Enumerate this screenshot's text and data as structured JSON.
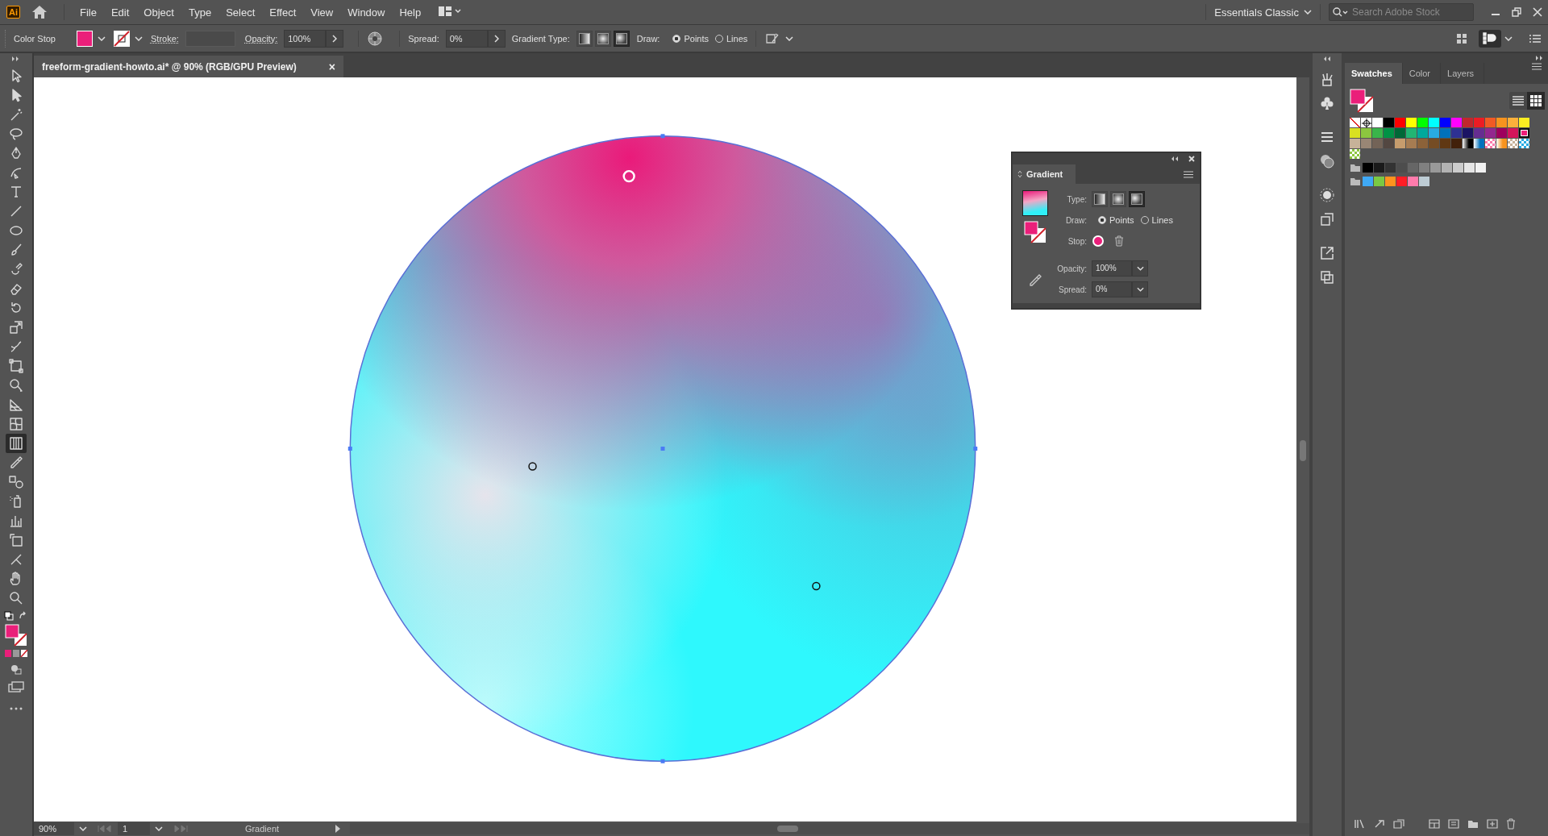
{
  "app_bar": {
    "logo": "Ai",
    "menu": [
      "File",
      "Edit",
      "Object",
      "Type",
      "Select",
      "Effect",
      "View",
      "Window",
      "Help"
    ],
    "workspace": "Essentials Classic",
    "search": {
      "placeholder": "Search Adobe Stock"
    }
  },
  "control_bar": {
    "label": "Color Stop",
    "stroke_label": "Stroke:",
    "opacity_label": "Opacity:",
    "opacity": "100%",
    "spread_label": "Spread:",
    "spread": "0%",
    "gradient_type_label": "Gradient Type:",
    "gradient_types": [
      {
        "kind": "linear",
        "selected": false
      },
      {
        "kind": "radial",
        "selected": false
      },
      {
        "kind": "freeform",
        "selected": true
      }
    ],
    "draw_label": "Draw:",
    "draw_options": [
      {
        "label": "Points",
        "selected": true
      },
      {
        "label": "Lines",
        "selected": false
      }
    ]
  },
  "document_tab": {
    "title": "freeform-gradient-howto.ai* @ 90% (RGB/GPU Preview)",
    "close": "×"
  },
  "tools": [
    {
      "kind": "selection",
      "selected": false
    },
    {
      "kind": "direct-selection",
      "selected": false
    },
    {
      "kind": "magic-wand",
      "selected": false
    },
    {
      "kind": "lasso",
      "selected": false
    },
    {
      "kind": "pen",
      "selected": false
    },
    {
      "kind": "curvature",
      "selected": false
    },
    {
      "kind": "type",
      "selected": false
    },
    {
      "kind": "line",
      "selected": false
    },
    {
      "kind": "ellipse",
      "selected": false
    },
    {
      "kind": "paintbrush",
      "selected": false
    },
    {
      "kind": "shaper",
      "selected": false
    },
    {
      "kind": "eraser",
      "selected": false
    },
    {
      "kind": "rotate",
      "selected": false
    },
    {
      "kind": "scale",
      "selected": false
    },
    {
      "kind": "warp",
      "selected": false
    },
    {
      "kind": "free-transform",
      "selected": false
    },
    {
      "kind": "shape-builder",
      "selected": false
    },
    {
      "kind": "perspective-grid",
      "selected": false
    },
    {
      "kind": "mesh",
      "selected": false
    },
    {
      "kind": "gradient",
      "selected": true
    },
    {
      "kind": "eyedropper",
      "selected": false
    },
    {
      "kind": "blend",
      "selected": false
    },
    {
      "kind": "symbol-sprayer",
      "selected": false
    },
    {
      "kind": "column-graph",
      "selected": false
    },
    {
      "kind": "artboard",
      "selected": false
    },
    {
      "kind": "slice",
      "selected": false
    },
    {
      "kind": "hand",
      "selected": false
    },
    {
      "kind": "zoom",
      "selected": false
    }
  ],
  "canvas": {
    "stops": [
      {
        "selected": true
      },
      {
        "selected": false
      },
      {
        "selected": false
      }
    ]
  },
  "gradient_panel": {
    "title": "Gradient",
    "type_label": "Type:",
    "types": [
      {
        "kind": "linear",
        "selected": false
      },
      {
        "kind": "radial",
        "selected": false
      },
      {
        "kind": "freeform",
        "selected": true
      }
    ],
    "draw_label": "Draw:",
    "draw_options": [
      {
        "label": "Points",
        "selected": true
      },
      {
        "label": "Lines",
        "selected": false
      }
    ],
    "stop_label": "Stop:",
    "opacity_label": "Opacity:",
    "opacity": "100%",
    "spread_label": "Spread:",
    "spread": "0%"
  },
  "dock_panel": {
    "tabs": [
      {
        "label": "Swatches",
        "selected": true
      },
      {
        "label": "Color",
        "selected": false
      },
      {
        "label": "Layers",
        "selected": false
      }
    ],
    "view_modes": [
      {
        "kind": "list",
        "selected": false
      },
      {
        "kind": "grid",
        "selected": true
      }
    ],
    "swatch_rows": [
      [
        {
          "kind": "none",
          "selected": false
        },
        {
          "kind": "registration",
          "selected": false
        },
        {
          "kind": "color",
          "color": "#ffffff",
          "selected": false
        },
        {
          "kind": "color",
          "color": "#000000",
          "selected": false
        },
        {
          "kind": "color",
          "color": "#ff0000",
          "selected": false
        },
        {
          "kind": "color",
          "color": "#ffff00",
          "selected": false
        },
        {
          "kind": "color",
          "color": "#00ff00",
          "selected": false
        },
        {
          "kind": "color",
          "color": "#00ffff",
          "selected": false
        },
        {
          "kind": "color",
          "color": "#0000ff",
          "selected": false
        },
        {
          "kind": "color",
          "color": "#ff00ff",
          "selected": false
        },
        {
          "kind": "color",
          "color": "#c1272d",
          "selected": false
        },
        {
          "kind": "color",
          "color": "#ed1c24",
          "selected": false
        },
        {
          "kind": "color",
          "color": "#f15a24",
          "selected": false
        },
        {
          "kind": "color",
          "color": "#f7931e",
          "selected": false
        },
        {
          "kind": "color",
          "color": "#fbb03b",
          "selected": false
        },
        {
          "kind": "color",
          "color": "#fcee21",
          "selected": false
        }
      ],
      [
        {
          "kind": "color",
          "color": "#d9e021",
          "selected": false
        },
        {
          "kind": "color",
          "color": "#8cc63f",
          "selected": false
        },
        {
          "kind": "color",
          "color": "#39b54a",
          "selected": false
        },
        {
          "kind": "color",
          "color": "#009245",
          "selected": false
        },
        {
          "kind": "color",
          "color": "#006837",
          "selected": false
        },
        {
          "kind": "color",
          "color": "#22b573",
          "selected": false
        },
        {
          "kind": "color",
          "color": "#00a99d",
          "selected": false
        },
        {
          "kind": "color",
          "color": "#29abe2",
          "selected": false
        },
        {
          "kind": "color",
          "color": "#0071bc",
          "selected": false
        },
        {
          "kind": "color",
          "color": "#2e3192",
          "selected": false
        },
        {
          "kind": "color",
          "color": "#1b1464",
          "selected": false
        },
        {
          "kind": "color",
          "color": "#662d91",
          "selected": false
        },
        {
          "kind": "color",
          "color": "#93278f",
          "selected": false
        },
        {
          "kind": "color",
          "color": "#9e005d",
          "selected": false
        },
        {
          "kind": "color",
          "color": "#d4145a",
          "selected": false
        },
        {
          "kind": "color",
          "color": "#ed1e79",
          "selected": true
        }
      ],
      [
        {
          "kind": "color",
          "color": "#c7b299",
          "selected": false
        },
        {
          "kind": "color",
          "color": "#998675",
          "selected": false
        },
        {
          "kind": "color",
          "color": "#736357",
          "selected": false
        },
        {
          "kind": "color",
          "color": "#534741",
          "selected": false
        },
        {
          "kind": "color",
          "color": "#c69c6d",
          "selected": false
        },
        {
          "kind": "color",
          "color": "#a67c52",
          "selected": false
        },
        {
          "kind": "color",
          "color": "#8c6239",
          "selected": false
        },
        {
          "kind": "color",
          "color": "#754c24",
          "selected": false
        },
        {
          "kind": "color",
          "color": "#603813",
          "selected": false
        },
        {
          "kind": "color",
          "color": "#42210b",
          "selected": false
        },
        {
          "kind": "gradient",
          "color": "#000000",
          "selected": false
        },
        {
          "kind": "gradient",
          "color": "#0071bc",
          "selected": false
        },
        {
          "kind": "pattern",
          "color": "#ff7bac",
          "selected": false
        },
        {
          "kind": "gradient",
          "color": "#f7931e",
          "selected": false
        },
        {
          "kind": "pattern",
          "color": "#c7b299",
          "selected": false
        },
        {
          "kind": "pattern",
          "color": "#29abe2",
          "selected": false
        }
      ],
      [
        {
          "kind": "pattern",
          "color": "#8cc63f",
          "selected": false
        }
      ]
    ],
    "swatch_groups": [
      [
        {
          "kind": "color",
          "color": "#000000",
          "selected": false
        },
        {
          "kind": "color",
          "color": "#1a1a1a",
          "selected": false
        },
        {
          "kind": "color",
          "color": "#333333",
          "selected": false
        },
        {
          "kind": "color",
          "color": "#4d4d4d",
          "selected": false
        },
        {
          "kind": "color",
          "color": "#666666",
          "selected": false
        },
        {
          "kind": "color",
          "color": "#808080",
          "selected": false
        },
        {
          "kind": "color",
          "color": "#999999",
          "selected": false
        },
        {
          "kind": "color",
          "color": "#b3b3b3",
          "selected": false
        },
        {
          "kind": "color",
          "color": "#cccccc",
          "selected": false
        },
        {
          "kind": "color",
          "color": "#e6e6e6",
          "selected": false
        },
        {
          "kind": "color",
          "color": "#f2f2f2",
          "selected": false
        }
      ],
      [
        {
          "kind": "color",
          "color": "#3fa9f5",
          "selected": false
        },
        {
          "kind": "color",
          "color": "#7ac943",
          "selected": false
        },
        {
          "kind": "color",
          "color": "#ff931e",
          "selected": false
        },
        {
          "kind": "color",
          "color": "#ff1d25",
          "selected": false
        },
        {
          "kind": "color",
          "color": "#ff7bac",
          "selected": false
        },
        {
          "kind": "color",
          "color": "#bdccd4",
          "selected": false
        }
      ]
    ]
  },
  "status_bar": {
    "zoom": "90%",
    "artboard": "1",
    "tool": "Gradient"
  }
}
